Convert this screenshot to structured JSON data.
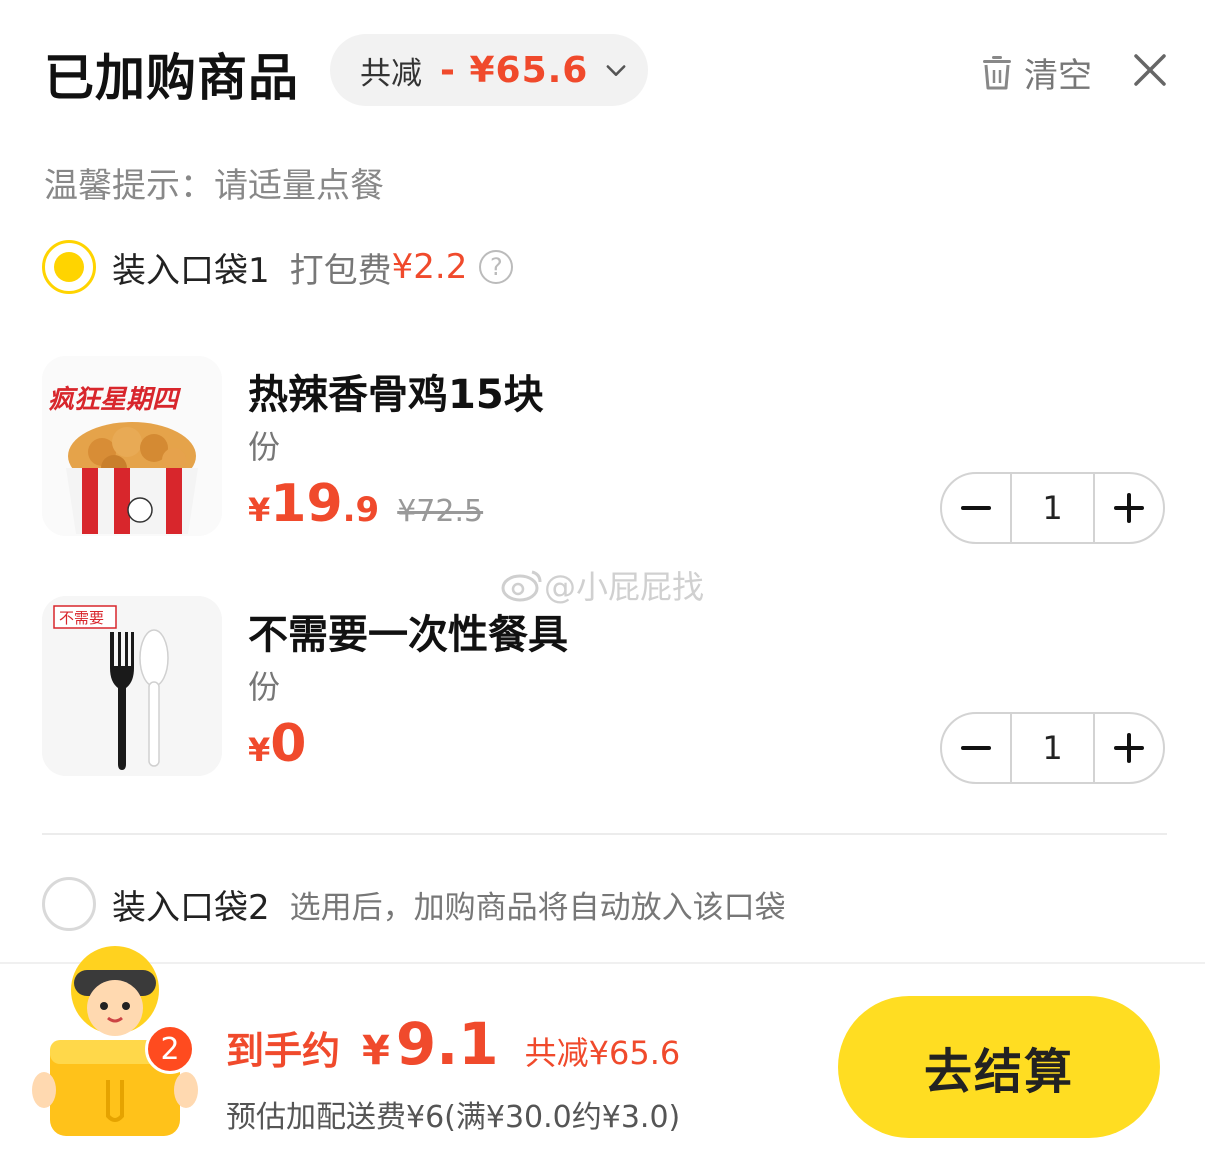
{
  "header": {
    "title": "已加购商品",
    "discount_label": "共减",
    "discount_amount": "- ¥65.6",
    "clear_label": "清空"
  },
  "tip": "温馨提示：请适量点餐",
  "bag1": {
    "label": "装入口袋1",
    "fee_label": "打包费",
    "fee": "¥2.2",
    "help": "?"
  },
  "items": [
    {
      "name": "热辣香骨鸡15块",
      "unit": "份",
      "price_currency": "¥",
      "price_int": "19",
      "price_dec": ".9",
      "original_price": "¥72.5",
      "qty": "1",
      "thumb_text": "疯狂星期四"
    },
    {
      "name": "不需要一次性餐具",
      "unit": "份",
      "price_currency": "¥",
      "price_int": "0",
      "price_dec": "",
      "original_price": "",
      "qty": "1",
      "thumb_text": "不需要"
    }
  ],
  "watermark": "@小屁屁找",
  "bag2": {
    "label": "装入口袋2",
    "hint": "选用后，加购商品将自动放入该口袋"
  },
  "footer": {
    "cart_count": "2",
    "final_label": "到手约",
    "final_currency": "¥",
    "final_amount": "9.1",
    "save_text": "共减¥65.6",
    "delivery_text": "预估加配送费¥6(满¥30.0约¥3.0)",
    "checkout_label": "去结算"
  },
  "colors": {
    "accent_red": "#f04a2c",
    "brand_yellow": "#ffdd22",
    "radio_yellow": "#ffd400"
  }
}
